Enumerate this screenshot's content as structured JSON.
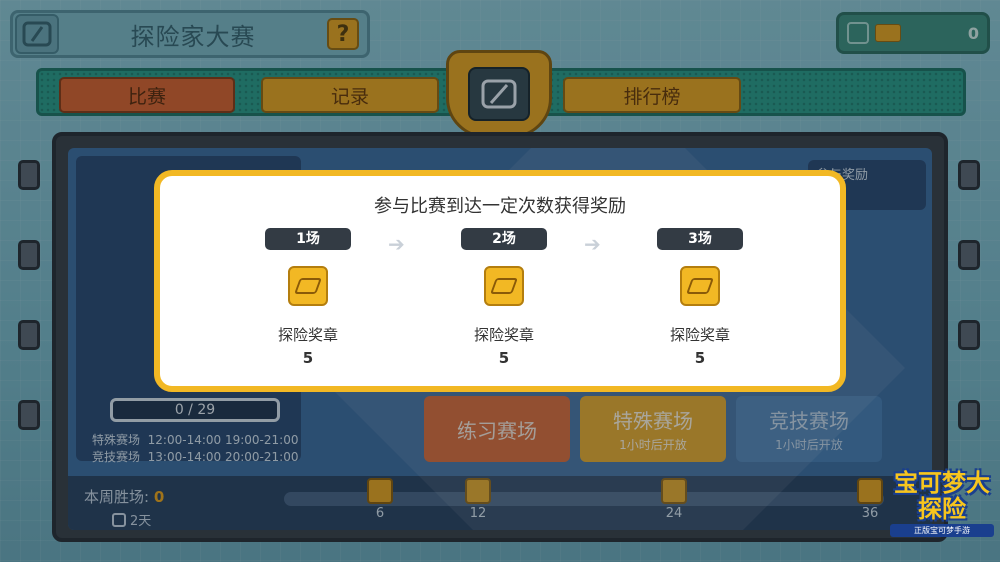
{
  "header": {
    "title": "探险家大赛",
    "help_label": "?",
    "currency_value": "0"
  },
  "tabs": [
    {
      "label": "比赛",
      "active": true
    },
    {
      "label": "记录",
      "active": false
    },
    {
      "label": "排行榜",
      "active": false
    }
  ],
  "background_panel": {
    "progress": "0 / 29",
    "schedule": [
      {
        "name": "特殊赛场",
        "times": "12:00-14:00 19:00-21:00"
      },
      {
        "name": "竞技赛场",
        "times": "13:00-14:00 20:00-21:00"
      }
    ],
    "reward_label": "参与奖励",
    "arenas": [
      {
        "label": "练习赛场",
        "sub": ""
      },
      {
        "label": "特殊赛场",
        "sub": "1小时后开放"
      },
      {
        "label": "竞技赛场",
        "sub": "1小时后开放"
      }
    ],
    "weekly_wins_label": "本周胜场:",
    "weekly_wins_value": "0",
    "days_left": "2天",
    "milestones": [
      "6",
      "12",
      "24",
      "36"
    ]
  },
  "popup": {
    "title": "参与比赛到达一定次数获得奖励",
    "rewards": [
      {
        "count": "1场",
        "name": "探险奖章",
        "qty": "5"
      },
      {
        "count": "2场",
        "name": "探险奖章",
        "qty": "5"
      },
      {
        "count": "3场",
        "name": "探险奖章",
        "qty": "5"
      }
    ]
  },
  "logo": {
    "main": "宝可梦大探险",
    "sub": "正版宝可梦手游"
  },
  "colors": {
    "popup_border": "#f2b824",
    "tab_active": "#d9632d",
    "tab_inactive": "#e8a51f"
  }
}
